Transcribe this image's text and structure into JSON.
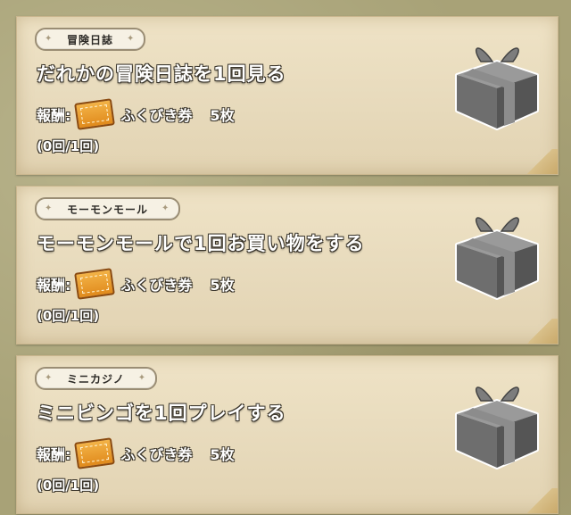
{
  "missions": [
    {
      "category": "冒険日誌",
      "title": "だれかの冒険日誌を1回見る",
      "reward_label": "報酬:",
      "reward_item": "ふくびき券",
      "reward_qty": "5枚",
      "progress": "(0回/1回)",
      "icon": "gift-box-icon"
    },
    {
      "category": "モーモンモール",
      "title": "モーモンモールで1回お買い物をする",
      "reward_label": "報酬:",
      "reward_item": "ふくびき券",
      "reward_qty": "5枚",
      "progress": "(0回/1回)",
      "icon": "gift-box-icon"
    },
    {
      "category": "ミニカジノ",
      "title": "ミニビンゴを1回プレイする",
      "reward_label": "報酬:",
      "reward_item": "ふくびき券",
      "reward_qty": "5枚",
      "progress": "(0回/1回)",
      "icon": "gift-box-icon"
    }
  ],
  "colors": {
    "background": "#a8a277",
    "card": "#e8dbbd",
    "ticket": "#e08a1c",
    "gift": "#777777"
  }
}
